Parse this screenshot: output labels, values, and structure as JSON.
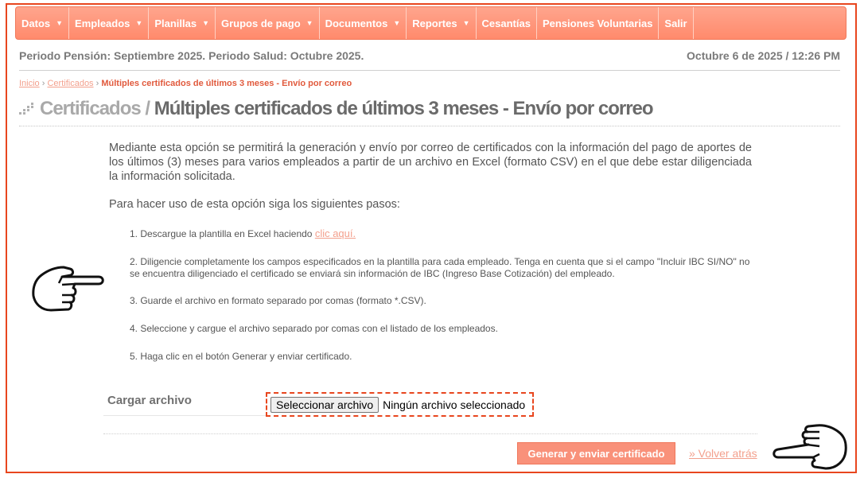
{
  "nav": {
    "items": [
      {
        "label": "Datos",
        "caret": true
      },
      {
        "label": "Empleados",
        "caret": true
      },
      {
        "label": "Planillas",
        "caret": true
      },
      {
        "label": "Grupos de pago",
        "caret": true
      },
      {
        "label": "Documentos",
        "caret": true
      },
      {
        "label": "Reportes",
        "caret": true
      },
      {
        "label": "Cesantías",
        "caret": false
      },
      {
        "label": "Pensiones Voluntarias",
        "caret": false
      },
      {
        "label": "Salir",
        "caret": false
      }
    ]
  },
  "status": {
    "period": "Periodo Pensión: Septiembre 2025. Periodo Salud: Octubre 2025.",
    "datetime": "Octubre 6 de 2025 / 12:26 PM"
  },
  "breadcrumb": {
    "home": "Inicio",
    "section": "Certificados",
    "current": "Múltiples certificados de últimos 3 meses - Envío por correo",
    "separator": "›"
  },
  "page": {
    "title_section": "Certificados /",
    "title_main": "Múltiples certificados de últimos 3 meses - Envío por correo",
    "intro": "Mediante esta opción se permitirá la generación y envío por correo de certificados con la información del pago de aportes de los últimos (3) meses para varios empleados a partir de un archivo en Excel (formato CSV) en el que debe estar diligenciada la información solicitada.",
    "lead": "Para hacer uso de esta opción siga los siguientes pasos:"
  },
  "steps": {
    "s1": {
      "text": "1. Descargue la plantilla en Excel haciendo ",
      "link": "clic aquí."
    },
    "s2": "2. Diligencie completamente los campos especificados en la plantilla para cada empleado. Tenga en cuenta que si el campo \"Incluir IBC SI/NO\" no se encuentra diligenciado el certificado se enviará sin información de IBC (Ingreso Base Cotización) del empleado.",
    "s3": "3. Guarde el archivo en formato separado por comas (formato *.CSV).",
    "s4": "4. Seleccione y cargue el archivo separado por comas con el listado de los empleados.",
    "s5": "5. Haga clic en el botón Generar y enviar certificado."
  },
  "upload": {
    "label": "Cargar archivo",
    "button": "Seleccionar archivo",
    "status": "Ningún archivo seleccionado"
  },
  "actions": {
    "submit": "Generar y enviar certificado",
    "back": "» Volver atrás"
  },
  "colors": {
    "accent": "#e8461e",
    "nav_bg": "#ff8a6c",
    "link": "#f3a08d",
    "button": "#f9917a"
  },
  "icons": [
    "caret-down-icon",
    "pointing-hand-right-icon",
    "pointing-hand-left-icon",
    "dots-icon"
  ]
}
